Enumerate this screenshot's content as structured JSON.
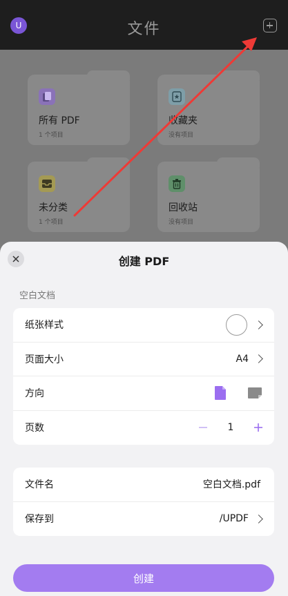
{
  "header": {
    "avatar_letter": "U",
    "title": "文件"
  },
  "folders": [
    {
      "name": "所有 PDF",
      "count": "1 个项目",
      "icon": "pdf-stack-icon"
    },
    {
      "name": "收藏夹",
      "count": "没有项目",
      "icon": "star-folder-icon"
    },
    {
      "name": "未分类",
      "count": "1 个项目",
      "icon": "inbox-tray-icon"
    },
    {
      "name": "回收站",
      "count": "没有项目",
      "icon": "trash-icon"
    }
  ],
  "sheet": {
    "title": "创建 PDF",
    "section_label": "空白文档",
    "paper_style_label": "纸张样式",
    "page_size_label": "页面大小",
    "page_size_value": "A4",
    "orientation_label": "方向",
    "page_count_label": "页数",
    "page_count_value": "1",
    "file_name_label": "文件名",
    "file_name_value": "空白文档.pdf",
    "save_to_label": "保存到",
    "save_to_value": "/UPDF",
    "create_button": "创建"
  },
  "colors": {
    "accent": "#a37cf0",
    "accent_text": "#9b6ef0",
    "avatar": "#7a56d6",
    "arrow": "#ee3a36"
  }
}
